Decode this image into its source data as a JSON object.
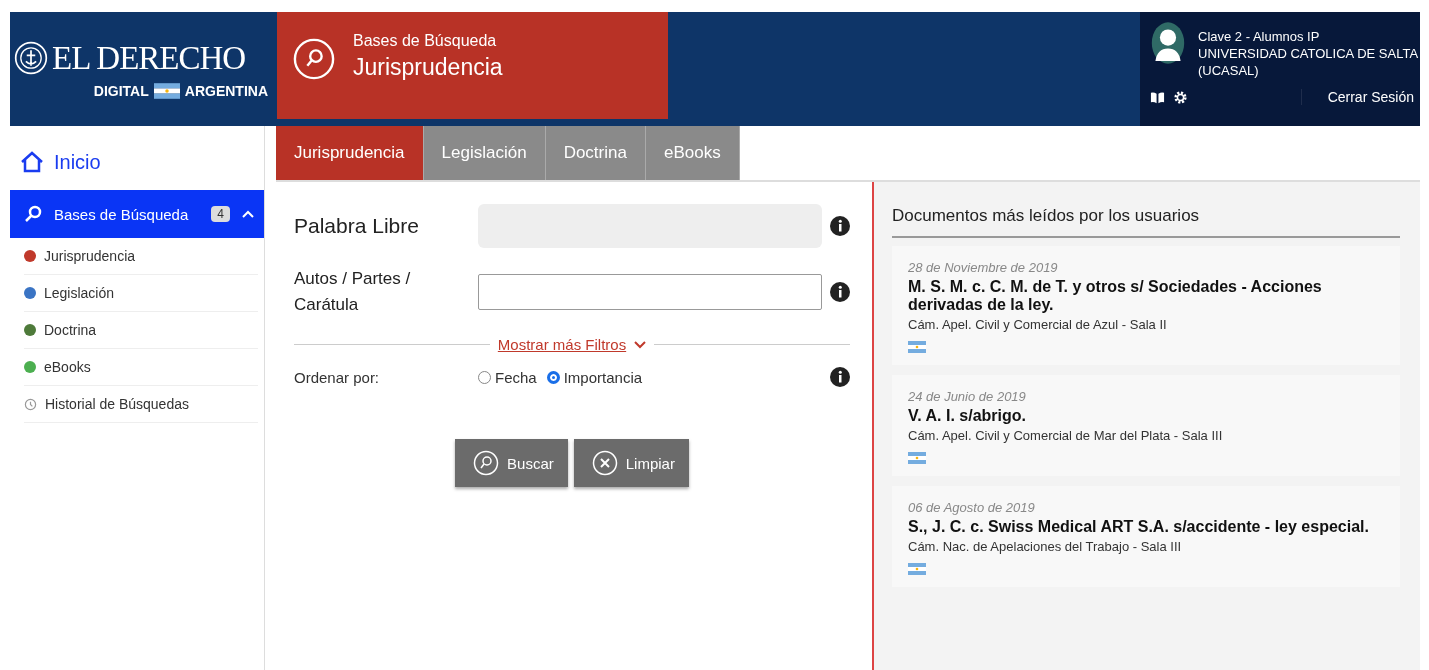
{
  "header": {
    "logo": {
      "title": "EL DERECHO",
      "left": "DIGITAL",
      "right": "ARGENTINA"
    },
    "section": {
      "label": "Bases de Búsqueda",
      "title": "Jurisprudencia"
    },
    "user": {
      "lines": [
        "Clave 2 - Alumnos IP",
        "UNIVERSIDAD CATOLICA DE SALTA",
        "(UCASAL)"
      ],
      "logout": "Cerrar Sesión"
    }
  },
  "tabs": [
    {
      "label": "Jurisprudencia",
      "selected": true
    },
    {
      "label": "Legislación",
      "selected": false
    },
    {
      "label": "Doctrina",
      "selected": false
    },
    {
      "label": "eBooks",
      "selected": false
    }
  ],
  "sidebar": {
    "home": "Inicio",
    "group": {
      "label": "Bases de Búsqueda",
      "count": "4",
      "expanded": true
    },
    "items": [
      {
        "kind": "dot",
        "label": "Jurisprudencia",
        "color": "#c0392b"
      },
      {
        "kind": "dot",
        "label": "Legislación",
        "color": "#3a74c4"
      },
      {
        "kind": "dot",
        "label": "Doctrina",
        "color": "#4e7a3a"
      },
      {
        "kind": "dot",
        "label": "eBooks",
        "color": "#4caf50"
      },
      {
        "kind": "history",
        "label": "Historial de Búsquedas"
      }
    ]
  },
  "form": {
    "fields": [
      {
        "label": "Palabra Libre",
        "kind": "filled"
      },
      {
        "label": "Autos / Partes / Carátula",
        "kind": "outlined"
      }
    ],
    "more_filters": "Mostrar más Filtros",
    "sort": {
      "label": "Ordenar por:",
      "options": [
        {
          "label": "Fecha",
          "selected": false
        },
        {
          "label": "Importancia",
          "selected": true
        }
      ]
    },
    "buttons": [
      {
        "label": "Buscar",
        "kind": "search"
      },
      {
        "label": "Limpiar",
        "kind": "clear"
      }
    ]
  },
  "panel": {
    "title": "Documentos más leídos por los usuarios",
    "documents": [
      {
        "date": "28 de Noviembre de 2019",
        "title": "M. S. M. c. C. M. de T. y otros s/ Sociedades - Acciones derivadas de la ley.",
        "court": "Cám. Apel. Civil y Comercial de Azul - Sala II"
      },
      {
        "date": "24 de Junio de 2019",
        "title": "V. A. I. s/abrigo.",
        "court": "Cám. Apel. Civil y Comercial de Mar del Plata - Sala III"
      },
      {
        "date": "06 de Agosto de 2019",
        "title": "S., J. C. c. Swiss Medical ART S.A. s/accidente - ley especial.",
        "court": "Cám. Nac. de Apelaciones del Trabajo - Sala III"
      }
    ]
  }
}
